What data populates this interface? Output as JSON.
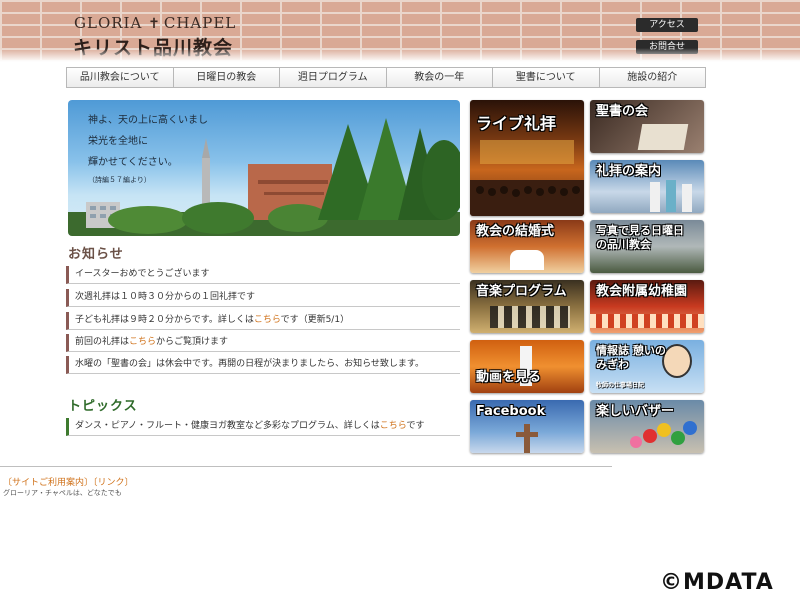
{
  "header": {
    "logo_en_left": "GLORIA",
    "logo_en_right": "CHAPEL",
    "logo_ja": "キリスト品川教会",
    "access_label": "アクセス",
    "contact_label": "お問合せ",
    "brick_color": "#d9a995"
  },
  "nav": [
    {
      "label": "品川教会について"
    },
    {
      "label": "日曜日の教会"
    },
    {
      "label": "週日プログラム"
    },
    {
      "label": "教会の一年"
    },
    {
      "label": "聖書について"
    },
    {
      "label": "施設の紹介"
    }
  ],
  "hero": {
    "line1": "神よ、天の上に高くいまし",
    "line2": "栄光を全地に",
    "line3": "輝かせてください。",
    "citation": "（詩編５７編より）"
  },
  "news": {
    "title": "お知らせ",
    "items": [
      {
        "text": "イースターおめでとうございます"
      },
      {
        "text": "次週礼拝は１０時３０分からの１回礼拝です"
      },
      {
        "pre": "子ども礼拝は９時２０分からです。詳しくは",
        "link": "こちら",
        "post": "です（更新5/1）"
      },
      {
        "pre": "前回の礼拝は",
        "link": "こちら",
        "post": "からご覧頂けます"
      },
      {
        "text": "水曜の「聖書の会」は休会中です。再開の日程が決まりましたら、お知らせ致します。"
      }
    ]
  },
  "topics": {
    "title": "トピックス",
    "items": [
      {
        "pre": "ダンス・ピアノ・フルート・健康ヨガ教室など多彩なプログラム、詳しくは",
        "link": "こちら",
        "post": "です"
      }
    ]
  },
  "tiles": [
    {
      "label": "ライブ礼拝"
    },
    {
      "label": "聖書の会"
    },
    {
      "label": "礼拝の案内"
    },
    {
      "label": "教会の結婚式"
    },
    {
      "label": "写真で見る日曜日の品川教会"
    },
    {
      "label": "音楽プログラム"
    },
    {
      "label": "教会附属幼稚園"
    },
    {
      "label": "動画を見る"
    },
    {
      "label": "情報誌 憩いのみぎわ",
      "sub": "牧師の仕事場日記"
    },
    {
      "label": "Facebook"
    },
    {
      "label": "楽しいバザー"
    }
  ],
  "footer": {
    "link1": "〔サイトご利用案内〕",
    "link2": "〔リンク〕",
    "note": "グローリア・チャペルは、どなたでも"
  },
  "watermark": "©MDATA"
}
